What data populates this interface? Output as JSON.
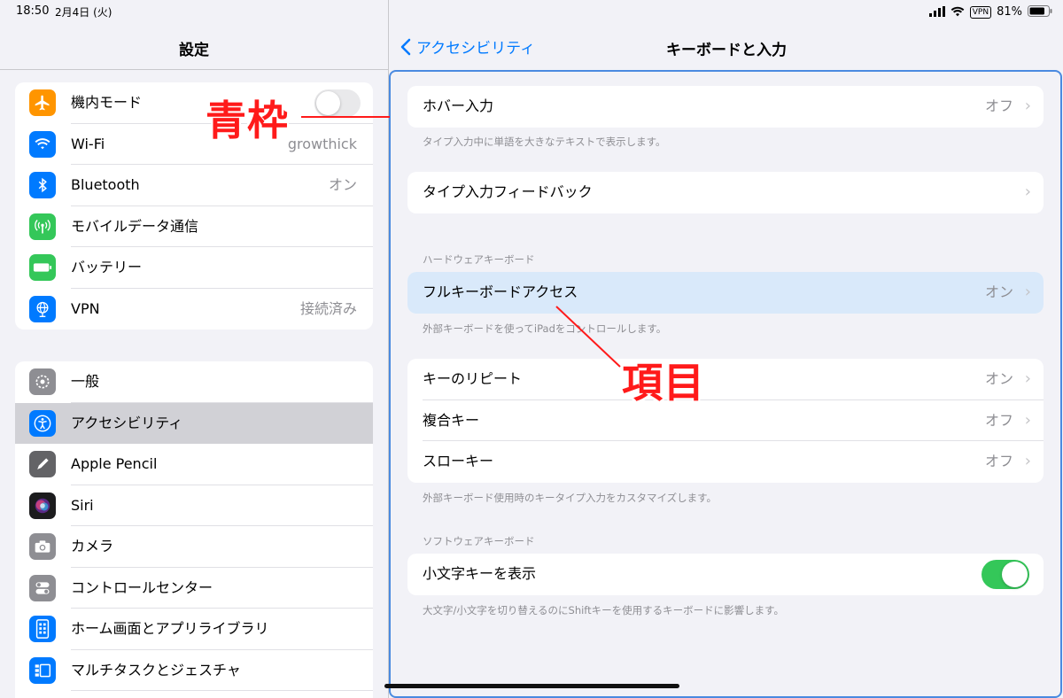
{
  "status_bar": {
    "time": "18:50",
    "date": "2月4日 (火)",
    "vpn": "VPN",
    "battery": "81%"
  },
  "sidebar": {
    "title": "設定",
    "group1": [
      {
        "label": "機内モード",
        "icon": "airplane-icon",
        "color": "#ff9500",
        "value": "",
        "toggle": "off"
      },
      {
        "label": "Wi-Fi",
        "icon": "wifi-icon",
        "color": "#007aff",
        "value": "growthick"
      },
      {
        "label": "Bluetooth",
        "icon": "bluetooth-icon",
        "color": "#007aff",
        "value": "オン"
      },
      {
        "label": "モバイルデータ通信",
        "icon": "antenna-icon",
        "color": "#34c759",
        "value": ""
      },
      {
        "label": "バッテリー",
        "icon": "battery-icon",
        "color": "#34c759",
        "value": ""
      },
      {
        "label": "VPN",
        "icon": "globe-icon",
        "color": "#007aff",
        "value": "接続済み"
      }
    ],
    "group2": [
      {
        "label": "一般",
        "icon": "gear-icon",
        "color": "#8e8e93"
      },
      {
        "label": "アクセシビリティ",
        "icon": "accessibility-icon",
        "color": "#007aff",
        "selected": true
      },
      {
        "label": "Apple Pencil",
        "icon": "pencil-icon",
        "color": "#636366"
      },
      {
        "label": "Siri",
        "icon": "siri-icon",
        "color": "#1c1c1e"
      },
      {
        "label": "カメラ",
        "icon": "camera-icon",
        "color": "#8e8e93"
      },
      {
        "label": "コントロールセンター",
        "icon": "switches-icon",
        "color": "#8e8e93"
      },
      {
        "label": "ホーム画面とアプリライブラリ",
        "icon": "home-screen-icon",
        "color": "#007aff"
      },
      {
        "label": "マルチタスクとジェスチャ",
        "icon": "multitask-icon",
        "color": "#007aff"
      }
    ]
  },
  "detail": {
    "back_label": "アクセシビリティ",
    "title": "キーボードと入力",
    "hover": {
      "label": "ホバー入力",
      "value": "オフ",
      "footnote": "タイプ入力中に単語を大きなテキストで表示します。"
    },
    "typing_feedback": {
      "label": "タイプ入力フィードバック"
    },
    "hardware_header": "ハードウェアキーボード",
    "full_keyboard": {
      "label": "フルキーボードアクセス",
      "value": "オン",
      "footnote": "外部キーボードを使ってiPadをコントロールします。"
    },
    "hardware_rows": [
      {
        "label": "キーのリピート",
        "value": "オン"
      },
      {
        "label": "複合キー",
        "value": "オフ"
      },
      {
        "label": "スローキー",
        "value": "オフ"
      }
    ],
    "hardware_footnote": "外部キーボード使用時のキータイプ入力をカスタマイズします。",
    "software_header": "ソフトウェアキーボード",
    "lowercase": {
      "label": "小文字キーを表示",
      "toggle": "on",
      "footnote": "大文字/小文字を切り替えるのにShiftキーを使用するキーボードに影響します。"
    }
  },
  "annotations": {
    "frame_label": "青枠",
    "item_label": "項目",
    "color": "#ff1a1a"
  }
}
